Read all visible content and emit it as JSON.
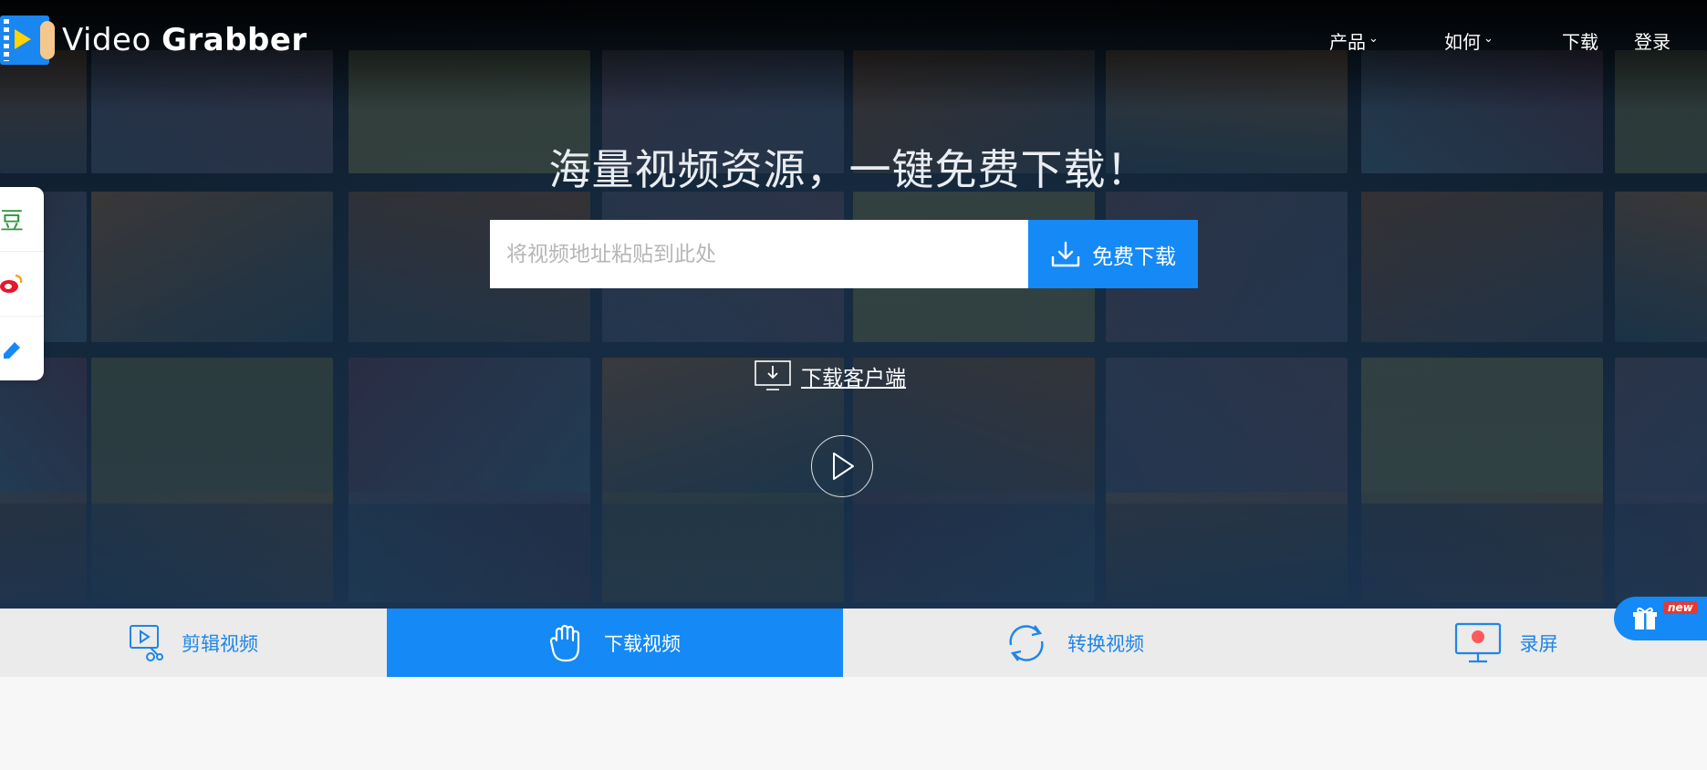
{
  "brand": {
    "prefix": "Video",
    "name": "Grabber"
  },
  "nav": {
    "products": "产品",
    "howto": "如何",
    "download": "下载",
    "login": "登录"
  },
  "hero": {
    "headline": "海量视频资源，一键免费下载！",
    "search_placeholder": "将视频地址粘贴到此处",
    "download_button": "免费下载",
    "client_link": "下载客户端"
  },
  "side_share": [
    {
      "icon": "douban-icon",
      "label": "豆",
      "color": "#2e963d"
    },
    {
      "icon": "weibo-icon",
      "color": "#e6162d"
    },
    {
      "icon": "pencil-icon",
      "color": "#1589f5"
    }
  ],
  "tabs": [
    {
      "label": "剪辑视频",
      "icon": "edit-video-icon",
      "active": false
    },
    {
      "label": "下载视频",
      "icon": "hand-icon",
      "active": true
    },
    {
      "label": "转换视频",
      "icon": "convert-icon",
      "active": false
    },
    {
      "label": "录屏",
      "icon": "screen-record-icon",
      "active": false
    }
  ],
  "gift": {
    "badge": "new",
    "icon": "gift-icon"
  },
  "colors": {
    "accent": "#1589f5",
    "tab_bar": "#ebebeb",
    "badge": "#e53935"
  }
}
